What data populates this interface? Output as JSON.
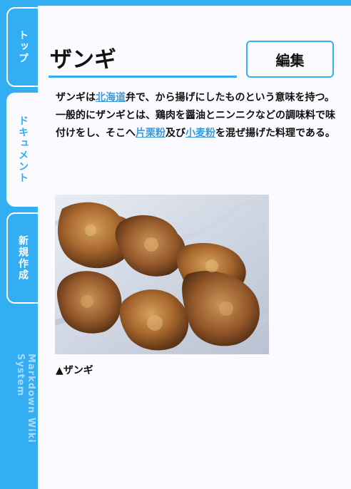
{
  "sidebar": {
    "tabs": [
      {
        "label": "トップ",
        "active": false
      },
      {
        "label": "ドキュメント",
        "active": true
      },
      {
        "label": "新規作成",
        "active": false
      }
    ],
    "brand": "Markdown Wiki System"
  },
  "page": {
    "title": "ザンギ",
    "edit_label": "編集"
  },
  "article": {
    "p1": "ザンギは",
    "link1": "北海道",
    "p2": "弁で、から揚げにしたものという意味を持つ。一般的にザンギとは、鶏肉を醤油とニンニクなどの調味料で味付けをし、そこへ",
    "link2": "片栗粉",
    "p3": "及び",
    "link3": "小麦粉",
    "p4": "を混ぜ揚げた料理である。"
  },
  "image": {
    "caption": "▲ザンギ",
    "alt": "ザンギ"
  },
  "colors": {
    "accent": "#33aef2",
    "link": "#3a9cd8",
    "background": "#fbfaff"
  }
}
